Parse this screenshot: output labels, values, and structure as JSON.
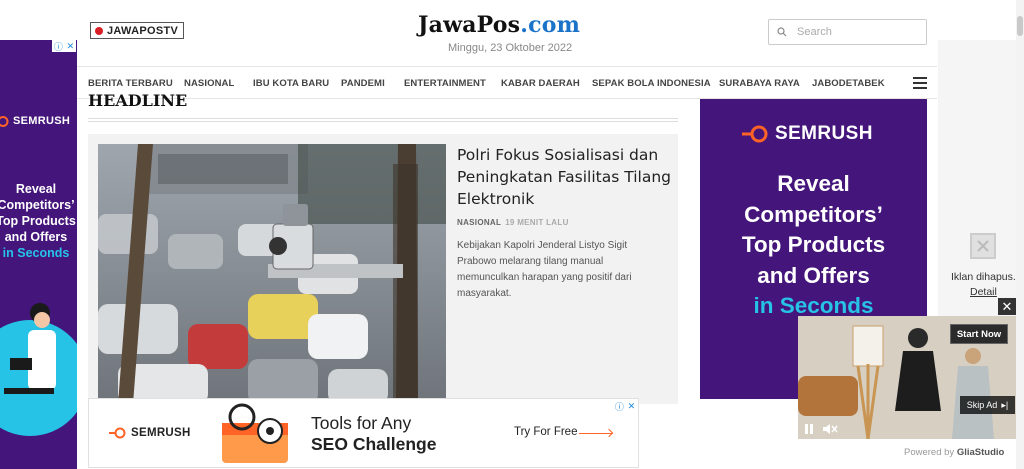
{
  "header": {
    "tv_badge": "JAWAPOSTV",
    "logo_main": "JawaPos",
    "logo_suffix": ".com",
    "date": "Minggu, 23 Oktober 2022",
    "search_placeholder": "Search"
  },
  "nav": {
    "items": [
      "BERITA TERBARU",
      "NASIONAL",
      "IBU KOTA BARU",
      "PANDEMI",
      "ENTERTAINMENT",
      "KABAR DAERAH",
      "SEPAK BOLA INDONESIA",
      "SURABAYA RAYA",
      "JABODETABEK"
    ],
    "menu_icon": "hamburger-icon"
  },
  "headline_section": {
    "title": "HEADLINE",
    "article": {
      "title": "Polri Fokus Sosialisasi dan Peningkatan Fasilitas Tilang Elektronik",
      "category": "NASIONAL",
      "time": "19 MENIT LALU",
      "excerpt": "Kebijakan Kapolri Jenderal Listyo Sigit Prabowo melarang tilang manual memunculkan harapan yang positif dari masyarakat."
    }
  },
  "ads": {
    "left": {
      "brand": "SEMRUSH",
      "line1": "Reveal",
      "line2": "Competitors’",
      "line3": "Top Products",
      "line4": "and Offers",
      "line5": "in Seconds"
    },
    "right": {
      "brand": "SEMRUSH",
      "line1": "Reveal",
      "line2": "Competitors’",
      "line3": "Top Products",
      "line4": "and Offers",
      "line5": "in Seconds"
    },
    "removed": {
      "text": "Iklan dihapus.",
      "detail": "Detail"
    },
    "bottom": {
      "brand": "SEMRUSH",
      "line1": "Tools for Any",
      "line2": "SEO Challenge",
      "cta": "Try For Free"
    },
    "video": {
      "start_label": "Start Now",
      "skip_label": "Skip Ad",
      "powered_prefix": "Powered by",
      "powered_brand": "GliaStudio"
    }
  },
  "colors": {
    "ad_purple": "#44157a",
    "ad_cyan": "#27c3e6",
    "semrush_orange": "#ff6326",
    "logo_blue": "#1a73c8"
  }
}
